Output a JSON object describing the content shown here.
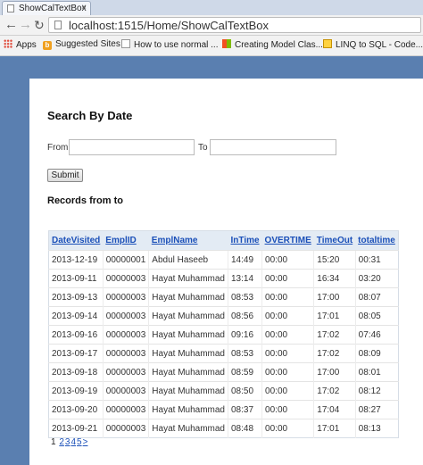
{
  "browser": {
    "tab_title": "ShowCalTextBox",
    "url": "localhost:1515/Home/ShowCalTextBox",
    "bookmarks": [
      {
        "label": "Apps",
        "icon": "apps-grid-icon"
      },
      {
        "label": "Suggested Sites",
        "icon": "bing-icon"
      },
      {
        "label": "How to use normal ...",
        "icon": "page-icon"
      },
      {
        "label": "Creating Model Clas...",
        "icon": "windows-icon"
      },
      {
        "label": "LINQ to SQL - Code...",
        "icon": "linq-icon"
      }
    ]
  },
  "page": {
    "heading": "Search By Date",
    "from_label": "From",
    "to_label": "To",
    "from_value": "",
    "to_value": "",
    "submit_label": "Submit",
    "records_label": "Records from to"
  },
  "table": {
    "columns": [
      "DateVisited",
      "EmplID",
      "EmplName",
      "InTime",
      "OVERTIME",
      "TimeOut",
      "totaltime"
    ],
    "rows": [
      [
        "2013-12-19",
        "00000001",
        "Abdul Haseeb",
        "14:49",
        "00:00",
        "15:20",
        "00:31"
      ],
      [
        "2013-09-11",
        "00000003",
        "Hayat Muhammad",
        "13:14",
        "00:00",
        "16:34",
        "03:20"
      ],
      [
        "2013-09-13",
        "00000003",
        "Hayat Muhammad",
        "08:53",
        "00:00",
        "17:00",
        "08:07"
      ],
      [
        "2013-09-14",
        "00000003",
        "Hayat Muhammad",
        "08:56",
        "00:00",
        "17:01",
        "08:05"
      ],
      [
        "2013-09-16",
        "00000003",
        "Hayat Muhammad",
        "09:16",
        "00:00",
        "17:02",
        "07:46"
      ],
      [
        "2013-09-17",
        "00000003",
        "Hayat Muhammad",
        "08:53",
        "00:00",
        "17:02",
        "08:09"
      ],
      [
        "2013-09-18",
        "00000003",
        "Hayat Muhammad",
        "08:59",
        "00:00",
        "17:00",
        "08:01"
      ],
      [
        "2013-09-19",
        "00000003",
        "Hayat Muhammad",
        "08:50",
        "00:00",
        "17:02",
        "08:12"
      ],
      [
        "2013-09-20",
        "00000003",
        "Hayat Muhammad",
        "08:37",
        "00:00",
        "17:04",
        "08:27"
      ],
      [
        "2013-09-21",
        "00000003",
        "Hayat Muhammad",
        "08:48",
        "00:00",
        "17:01",
        "08:13"
      ]
    ]
  },
  "pager": {
    "current": "1",
    "links": [
      "2",
      "3",
      "4",
      "5",
      ">"
    ]
  }
}
